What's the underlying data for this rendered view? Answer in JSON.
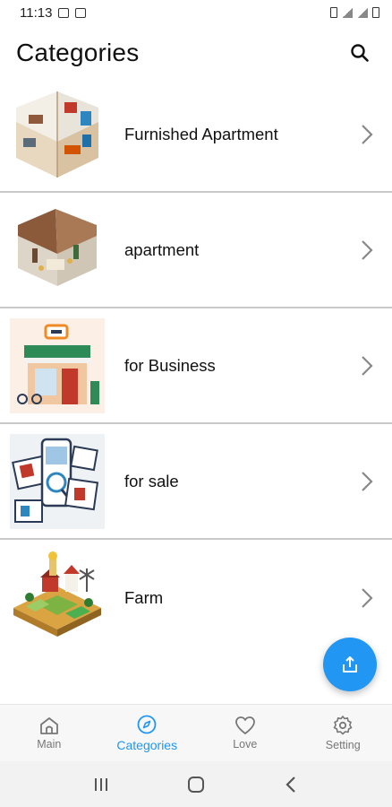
{
  "status_bar": {
    "time": "11:13",
    "icons": [
      "image-icon",
      "message-icon",
      "alarm-icon",
      "signal-icon",
      "battery-icon"
    ]
  },
  "header": {
    "title": "Categories",
    "search_icon": "search-icon"
  },
  "categories": [
    {
      "label": "Furnished Apartment",
      "thumbnail": "furnished-apartment-illustration"
    },
    {
      "label": "apartment",
      "thumbnail": "apartment-illustration"
    },
    {
      "label": "for Business",
      "thumbnail": "shop-illustration"
    },
    {
      "label": "for sale",
      "thumbnail": "real-estate-phone-illustration"
    },
    {
      "label": "Farm",
      "thumbnail": "farm-illustration"
    }
  ],
  "fab": {
    "icon": "share-icon"
  },
  "bottom_nav": {
    "active": "Categories",
    "items": [
      {
        "label": "Main",
        "icon": "home-icon"
      },
      {
        "label": "Categories",
        "icon": "categories-icon"
      },
      {
        "label": "Love",
        "icon": "heart-icon"
      },
      {
        "label": "Setting",
        "icon": "gear-icon"
      }
    ]
  },
  "colors": {
    "accent": "#2196f3",
    "divider": "#c9c9c9",
    "nav_background": "#f7f7f7"
  }
}
